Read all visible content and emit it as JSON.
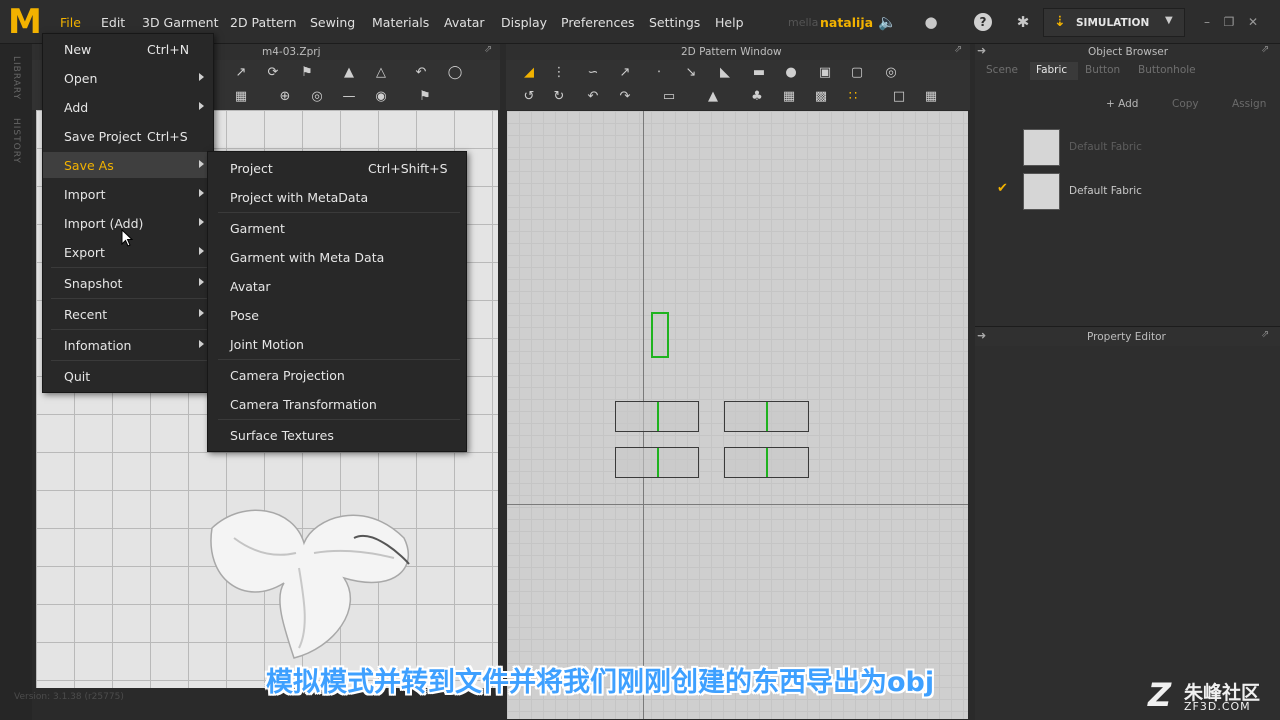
{
  "app": {
    "logo": "M",
    "menu": [
      "File",
      "Edit",
      "3D Garment",
      "2D Pattern",
      "Sewing",
      "Materials",
      "Avatar",
      "Display",
      "Preferences",
      "Settings",
      "Help"
    ],
    "user_prefix": "mella",
    "user": "natalija",
    "simulation_label": "SIMULATION",
    "version": "Version: 3.1.38 (r25775)"
  },
  "left_strip": {
    "library": "LIBRARY",
    "history": "HISTORY"
  },
  "panel3d": {
    "title": "m4-03.Zprj"
  },
  "panel2d": {
    "title": "2D Pattern Window"
  },
  "object_browser": {
    "title": "Object Browser",
    "tabs": [
      "Scene",
      "Fabric",
      "Button",
      "Buttonhole"
    ],
    "active_tab": "Fabric",
    "buttons": [
      "+ Add",
      "Copy",
      "Assign"
    ],
    "fabrics": [
      {
        "name": "Default Fabric",
        "selected": false
      },
      {
        "name": "Default Fabric",
        "selected": true
      }
    ]
  },
  "property_editor": {
    "title": "Property Editor"
  },
  "file_menu": {
    "items": [
      {
        "label": "New",
        "shortcut": "Ctrl+N",
        "submenu": false
      },
      {
        "label": "Open",
        "shortcut": "",
        "submenu": true
      },
      {
        "label": "Add",
        "shortcut": "",
        "submenu": true
      },
      {
        "label": "Save Project",
        "shortcut": "Ctrl+S",
        "submenu": false
      },
      {
        "label": "Save As",
        "shortcut": "",
        "submenu": true,
        "highlighted": true
      },
      {
        "label": "Import",
        "shortcut": "",
        "submenu": true
      },
      {
        "label": "Import (Add)",
        "shortcut": "",
        "submenu": true
      },
      {
        "label": "Export",
        "shortcut": "",
        "submenu": true
      },
      {
        "label": "Snapshot",
        "shortcut": "",
        "submenu": true
      },
      {
        "label": "Recent",
        "shortcut": "",
        "submenu": true
      },
      {
        "label": "Infomation",
        "shortcut": "",
        "submenu": true
      },
      {
        "label": "Quit",
        "shortcut": "",
        "submenu": false
      }
    ]
  },
  "save_as_menu": {
    "items": [
      {
        "label": "Project",
        "shortcut": "Ctrl+Shift+S"
      },
      {
        "label": "Project with MetaData",
        "shortcut": ""
      },
      {
        "label": "Garment",
        "shortcut": ""
      },
      {
        "label": "Garment with Meta Data",
        "shortcut": ""
      },
      {
        "label": "Avatar",
        "shortcut": ""
      },
      {
        "label": "Pose",
        "shortcut": ""
      },
      {
        "label": "Joint Motion",
        "shortcut": ""
      },
      {
        "label": "Camera Projection",
        "shortcut": ""
      },
      {
        "label": "Camera Transformation",
        "shortcut": ""
      },
      {
        "label": "Surface Textures",
        "shortcut": ""
      }
    ]
  },
  "subtitle": "模拟模式并转到文件并将我们刚刚创建的东西导出为obj",
  "watermark": {
    "cn": "朱峰社区",
    "en": "ZF3D.COM",
    "mark": "Z"
  },
  "colors": {
    "accent": "#f2b200",
    "seam": "#1fb31f",
    "subtitle": "#3ea0ff"
  }
}
